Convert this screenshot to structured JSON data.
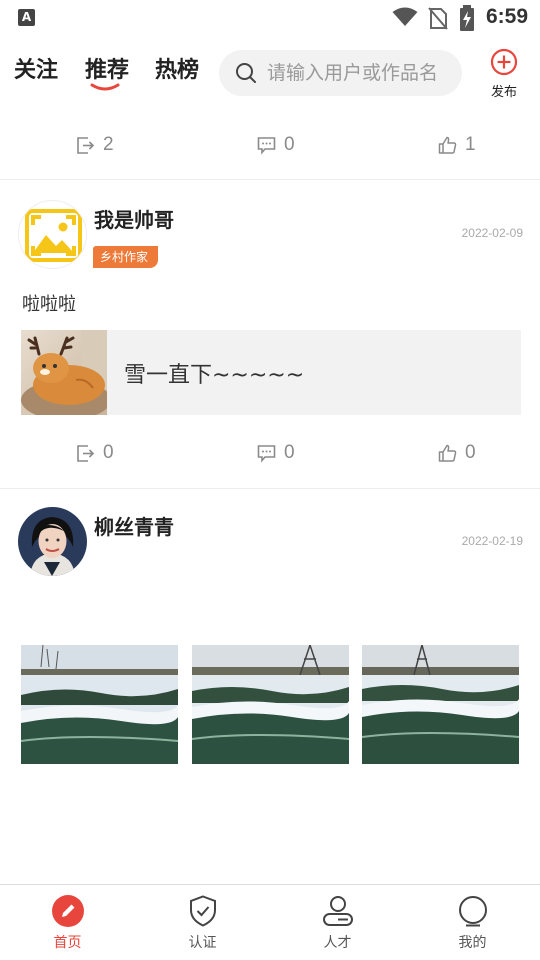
{
  "status_bar": {
    "time": "6:59",
    "notification_glyph": "A"
  },
  "header": {
    "tabs": [
      {
        "label": "关注",
        "active": false
      },
      {
        "label": "推荐",
        "active": true
      },
      {
        "label": "热榜",
        "active": false
      }
    ],
    "search_placeholder": "请输入用户或作品名",
    "publish_label": "发布",
    "accent_color": "#e8453c"
  },
  "feed": {
    "top_partial_post": {
      "shares": "2",
      "comments": "0",
      "likes": "1"
    },
    "posts": [
      {
        "user": "我是帅哥",
        "date": "2022-02-09",
        "badge": "乡村作家",
        "text": "啦啦啦",
        "link_card": {
          "title": "雪一直下~~~~~",
          "thumb": "cat-with-antlers-photo"
        },
        "shares": "0",
        "comments": "0",
        "likes": "0"
      },
      {
        "user": "柳丝青青",
        "date": "2022-02-19",
        "photos": [
          "snowy-field-photo",
          "snowy-field-photo",
          "snowy-field-photo"
        ]
      }
    ]
  },
  "bottom_nav": [
    {
      "label": "首页",
      "icon": "home-pen-icon",
      "active": true
    },
    {
      "label": "认证",
      "icon": "shield-check-icon",
      "active": false
    },
    {
      "label": "人才",
      "icon": "person-icon",
      "active": false
    },
    {
      "label": "我的",
      "icon": "profile-circle-icon",
      "active": false
    }
  ]
}
